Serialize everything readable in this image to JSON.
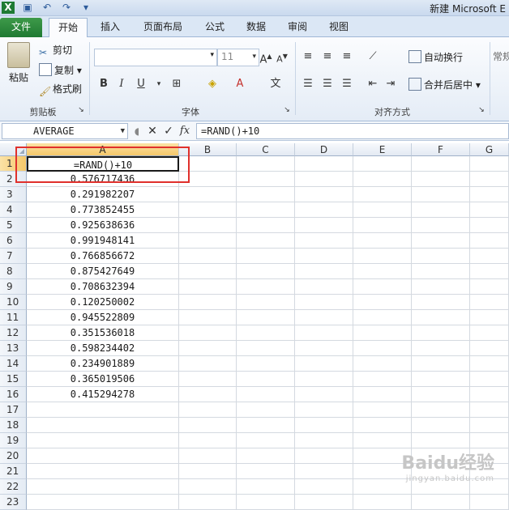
{
  "window": {
    "title": "新建 Microsoft E"
  },
  "tabs": [
    {
      "label": "文件",
      "key": "file"
    },
    {
      "label": "开始",
      "key": "home"
    },
    {
      "label": "插入",
      "key": "insert"
    },
    {
      "label": "页面布局",
      "key": "layout"
    },
    {
      "label": "公式",
      "key": "formulas"
    },
    {
      "label": "数据",
      "key": "data"
    },
    {
      "label": "审阅",
      "key": "review"
    },
    {
      "label": "视图",
      "key": "view"
    }
  ],
  "ribbon": {
    "clipboard": {
      "paste": "粘贴",
      "cut": "剪切",
      "copy": "复制",
      "format_painter": "格式刷",
      "label": "剪贴板"
    },
    "font": {
      "size": "11",
      "label": "字体"
    },
    "align": {
      "wrap": "自动换行",
      "merge": "合并后居中",
      "label": "对齐方式"
    },
    "number": {
      "format": "常规"
    }
  },
  "formula_bar": {
    "name_box": "AVERAGE",
    "fx": "fx",
    "formula": "=RAND()+10"
  },
  "columns": [
    "A",
    "B",
    "C",
    "D",
    "E",
    "F",
    "G"
  ],
  "selected_column": "A",
  "rows": [
    {
      "n": "1",
      "a": "=RAND()+10"
    },
    {
      "n": "2",
      "a": "0.576717436"
    },
    {
      "n": "3",
      "a": "0.291982207"
    },
    {
      "n": "4",
      "a": "0.773852455"
    },
    {
      "n": "5",
      "a": "0.925638636"
    },
    {
      "n": "6",
      "a": "0.991948141"
    },
    {
      "n": "7",
      "a": "0.766856672"
    },
    {
      "n": "8",
      "a": "0.875427649"
    },
    {
      "n": "9",
      "a": "0.708632394"
    },
    {
      "n": "10",
      "a": "0.120250002"
    },
    {
      "n": "11",
      "a": "0.945522809"
    },
    {
      "n": "12",
      "a": "0.351536018"
    },
    {
      "n": "13",
      "a": "0.598234402"
    },
    {
      "n": "14",
      "a": "0.234901889"
    },
    {
      "n": "15",
      "a": "0.365019506"
    },
    {
      "n": "16",
      "a": "0.415294278"
    },
    {
      "n": "17",
      "a": ""
    },
    {
      "n": "18",
      "a": ""
    },
    {
      "n": "19",
      "a": ""
    },
    {
      "n": "20",
      "a": ""
    },
    {
      "n": "21",
      "a": ""
    },
    {
      "n": "22",
      "a": ""
    },
    {
      "n": "23",
      "a": ""
    }
  ],
  "watermark": {
    "main": "Baidu经验",
    "sub": "jingyan.baidu.com"
  },
  "colors": {
    "file_tab": "#1f7a32",
    "highlight_box": "#e0302c",
    "selected_header": "#f5c76a"
  }
}
